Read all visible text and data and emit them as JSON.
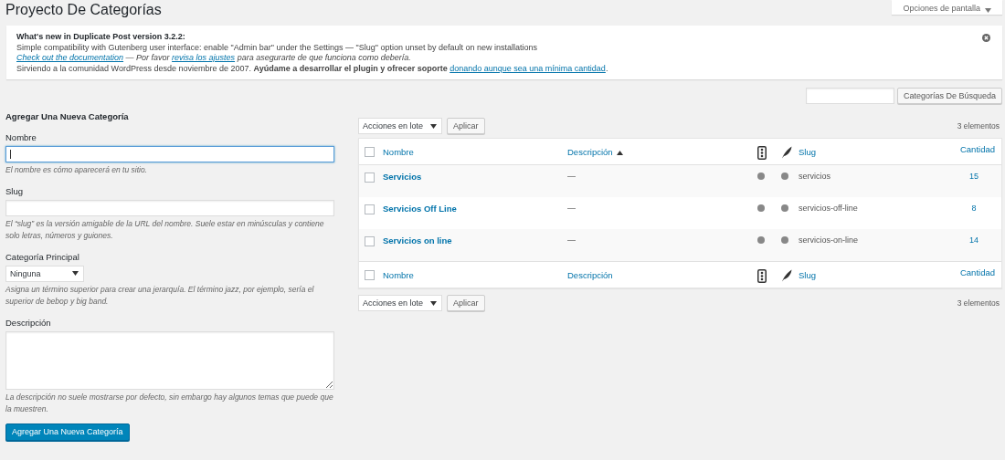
{
  "page_title": "Proyecto De Categorías",
  "screen_options": "Opciones de pantalla",
  "notice": {
    "heading": "What's new in Duplicate Post version 3.2.2:",
    "line_1": "Simple compatibility with Gutenberg user interface: enable \"Admin bar\" under the Settings — \"Slug\" option unset by default on new installations",
    "line_2": [
      {
        "kind": "link",
        "text": "Check out the documentation"
      },
      {
        "kind": "text",
        "text": " — Por favor "
      },
      {
        "kind": "link",
        "text": "revisa los ajustes"
      },
      {
        "kind": "text",
        "text": " para asegurarte de que funciona como debería."
      }
    ],
    "line_3": "Sirviendo a la comunidad WordPress desde noviembre de 2007. **Ayúdame a desarrollar el plugin y ofrecer soporte** ",
    "line_3_link": "donando aunque sea una mínima cantidad",
    "line_3_end": "."
  },
  "search_button": "Categorías De Búsqueda",
  "form": {
    "heading": "Agregar Una Nueva Categoría",
    "name_label": "Nombre",
    "name_focused": true,
    "name_hint": "El nombre es cómo aparecerá en tu sitio.",
    "slug_label": "Slug",
    "slug_hint": "El “slug” es la versión amigable de la URL del nombre. Suele estar en minúsculas y contiene solo letras, números y guiones.",
    "parent_label": "Categoría Principal",
    "parent_value": "Ninguna",
    "parent_hint": "Asigna un término superior para crear una jerarquía. El término jazz, por ejemplo, sería el superior de bebop y big band.",
    "description_label": "Descripción",
    "description_hint": "La descripción no suele mostrarse por defecto, sin embargo hay algunos temas que puede que la muestren.",
    "submit": "Agregar Una Nueva Categoría"
  },
  "bulk_actions": "Acciones en lote",
  "apply": "Aplicar",
  "item_count": "3 elementos",
  "table": {
    "header_checked": false,
    "columns": [
      {
        "label": "Nombre",
        "sorted": false
      },
      {
        "label": "Descripción",
        "sorted": true
      },
      {
        "label": "Slug",
        "sorted": false
      },
      {
        "label": "Cantidad",
        "sorted": false
      }
    ],
    "rows": [
      {
        "name": "Servicios",
        "description": "—",
        "slug": "servicios",
        "count": "15",
        "checked": false
      },
      {
        "name": "Servicios Off Line",
        "description": "—",
        "slug": "servicios-off-line",
        "count": "8",
        "checked": false
      },
      {
        "name": "Servicios on line",
        "description": "—",
        "slug": "servicios-on-line",
        "count": "14",
        "checked": false
      }
    ],
    "footer_checked": false,
    "footer_columns": [
      "Nombre",
      "Descripción",
      "Slug",
      "Cantidad"
    ]
  },
  "bulk_actions_bottom": "Acciones en lote",
  "apply_bottom": "Aplicar",
  "item_count_bottom": "3 elementos"
}
